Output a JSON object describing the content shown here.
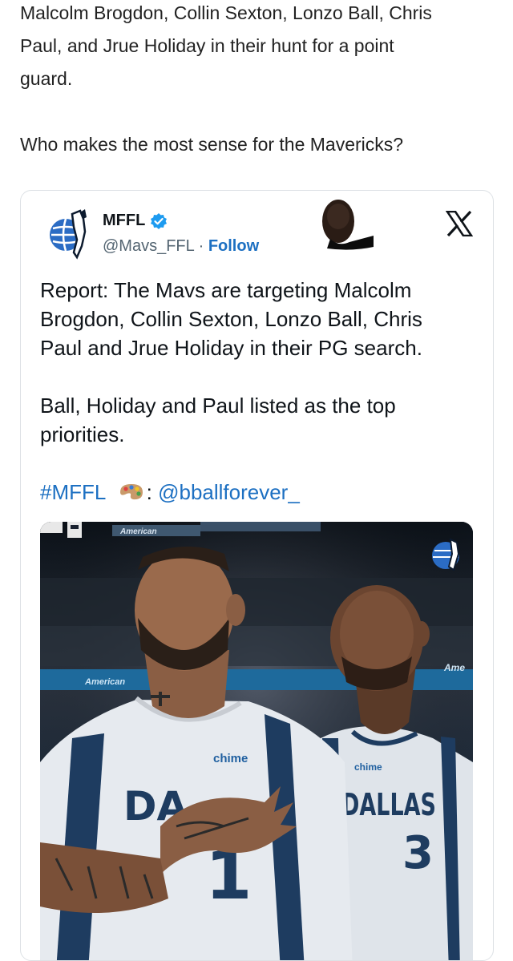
{
  "post": {
    "line1": "Malcolm Brogdon, Collin Sexton, Lonzo Ball, Chris",
    "line2": "Paul, and Jrue Holiday in their hunt for a point",
    "line3": "guard.",
    "question": "Who makes the most sense for the Mavericks?"
  },
  "embed": {
    "name": "MFFL",
    "handle": "@Mavs_FFL",
    "separator": " · ",
    "follow_label": "Follow",
    "body_line1": "Report: The Mavs are targeting Malcolm",
    "body_line2": "Brogdon, Collin Sexton, Lonzo Ball, Chris",
    "body_line3": "Paul and Jrue Holiday in their PG search.",
    "body_para2_line1": "Ball, Holiday and Paul listed as the top",
    "body_para2_line2": "priorities.",
    "hashtag": "#MFFL",
    "credit_colon": ":",
    "credit_handle": "@bballforever_"
  },
  "media": {
    "jersey_left_sponsor": "chime",
    "jersey_left_letters": "DA",
    "jersey_left_number": "1",
    "jersey_right_sponsor": "chime",
    "jersey_right_letters": "DALLAS",
    "jersey_right_number": "3",
    "arena_banner_1": "American",
    "arena_banner_2": "American",
    "arena_banner_3": "Ame"
  },
  "colors": {
    "link": "#1d70c2",
    "verified": "#1d9bf0",
    "text": "#0f1419",
    "muted": "#536471"
  }
}
